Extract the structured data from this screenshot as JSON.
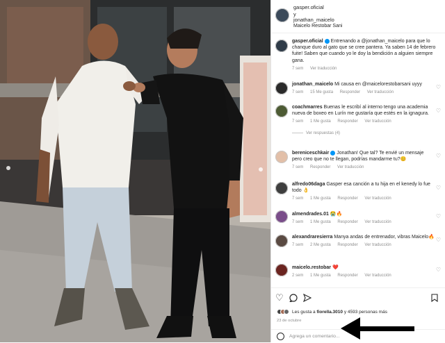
{
  "header": {
    "username": "gasper.oficial",
    "conjunction": "y",
    "collaborator": "jonathan_maicelo",
    "location": "Maicelo Restobar Sani"
  },
  "caption": {
    "username": "gasper.oficial",
    "text": "Entrenando a @jonathan_maicelo para que lo chanque duro al gato que se cree pantera. Ya saben 14 de febrero fuite! Saben que cuando yo le doy la bendición a alguien siempre gana.",
    "time": "7 sem",
    "translate": "Ver traducción"
  },
  "comments": [
    {
      "username": "jonathan_maicelo",
      "text": "Mi causa en @maicelorestobarsani uyyy",
      "time": "7 sem",
      "likes": "15 Me gusta",
      "reply": "Responder",
      "translate": "Ver traducción"
    },
    {
      "username": "coachmarres",
      "text": "Buenas le escribí al interno tengo una academia nueva de boxeo en Lurín me gustaría que estés en la ignagura.",
      "time": "7 sem",
      "likes": "1 Me gusta",
      "reply": "Responder",
      "translate": "Ver traducción",
      "view_replies": "Ver respuestas (4)"
    },
    {
      "username": "berenicesch­kair",
      "text": "Jonathan! Que tal? Te envié un mensaje pero creo que no te llegan, podrías mandarme tu?😊",
      "time": "7 sem",
      "likes": "",
      "reply": "Responder",
      "translate": "Ver traducción"
    },
    {
      "username": "alfredo06daga",
      "text": "Gasper esa canción a tu hija en el kenedy lo fue todo 👌",
      "time": "7 sem",
      "likes": "1 Me gusta",
      "reply": "Responder",
      "translate": "Ver traducción"
    },
    {
      "username": "almendrades.01",
      "text": "😭🔥",
      "time": "7 sem",
      "likes": "1 Me gusta",
      "reply": "Responder",
      "translate": "Ver traducción"
    },
    {
      "username": "alexandraresierra",
      "text": "Manya andas de entrenador, vibras Maicelo🔥",
      "time": "7 sem",
      "likes": "2 Me gusta",
      "reply": "Responder",
      "translate": "Ver traducción"
    },
    {
      "username": "maicelo.restobar",
      "text": "❤️",
      "time": "2 sem",
      "likes": "1 Me gusta",
      "reply": "Responder",
      "translate": "Ver traducción"
    }
  ],
  "actions": {
    "liked_by_prefix": "Les gusta a",
    "liked_by_user": "fiorella.3010",
    "liked_by_suffix": "y 4593 personas más",
    "date": "23 de octubre",
    "comment_placeholder": "Agrega un comentario..."
  },
  "colors": {
    "accent": "#0095f6",
    "muted": "#8e8e8e",
    "arrow": "#000000"
  }
}
